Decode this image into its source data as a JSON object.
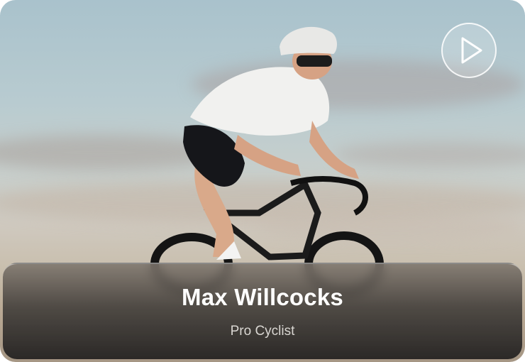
{
  "profile": {
    "name": "Max Willcocks",
    "role": "Pro Cyclist"
  },
  "media": {
    "play_icon": "play-icon",
    "subject": "cyclist-photo"
  },
  "colors": {
    "panel_text": "#ffffff",
    "subtitle_text": "#d9d6d2"
  }
}
